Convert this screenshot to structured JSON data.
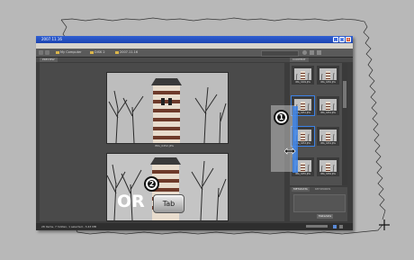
{
  "window": {
    "title": "2007.11.16",
    "menu": [
      "File",
      "Edit",
      "View",
      "Stacks",
      "Label",
      "Tools",
      "Window",
      "Help"
    ]
  },
  "toolbar": {
    "crumbs": [
      "My Computer",
      "DISK 2",
      "2007.11.16"
    ]
  },
  "tabs": {
    "preview": "PREVIEW",
    "content": "CONTENT",
    "metadata": "METADATA",
    "keywords": "KEYWORDS"
  },
  "preview": {
    "top_caption": "IMG_0452.JPG"
  },
  "content_thumbs": [
    {
      "label": "IMG_0449.JPG",
      "icon": "tower-thumbnail"
    },
    {
      "label": "IMG_0450.JPG",
      "icon": "tower-thumbnail"
    },
    {
      "label": "IMG_0451.JPG",
      "icon": "tower-thumbnail"
    },
    {
      "label": "IMG_0452.JPG",
      "icon": "tower-thumbnail"
    },
    {
      "label": "IMG_0453.JPG",
      "icon": "tower-thumbnail"
    },
    {
      "label": "IMG_0454.JPG",
      "icon": "tower-thumbnail"
    },
    {
      "label": "IMG_0455.JPG",
      "icon": "tower-thumbnail"
    },
    {
      "label": "IMG_0456.JPG",
      "icon": "tower-thumbnail"
    }
  ],
  "metadata": {
    "filter": "Metadata"
  },
  "statusbar": {
    "count": "28 items, 7 hidden, 1 selected - 3.43 MB"
  },
  "overlay": {
    "callout_1": "1",
    "callout_2": "2",
    "or_label": "OR",
    "key_label": "Tab"
  },
  "colors": {
    "titlebar": "#1d44b0",
    "selection": "#3c82e6",
    "background": "#b8b8b8"
  }
}
